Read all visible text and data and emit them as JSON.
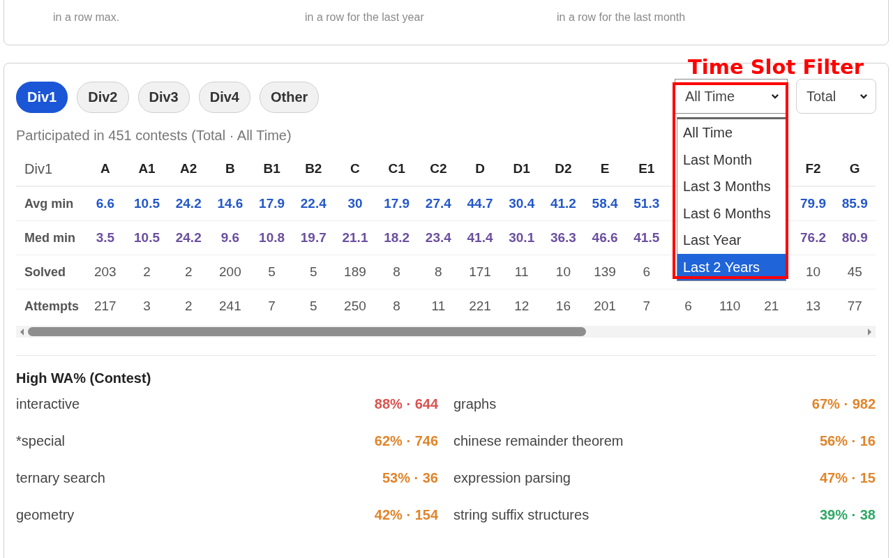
{
  "streaks": [
    {
      "caption": "in a row max."
    },
    {
      "caption": "in a row for the last year"
    },
    {
      "caption": "in a row for the last month"
    }
  ],
  "division_tabs": [
    {
      "label": "Div1",
      "selected": true
    },
    {
      "label": "Div2",
      "selected": false
    },
    {
      "label": "Div3",
      "selected": false
    },
    {
      "label": "Div4",
      "selected": false
    },
    {
      "label": "Other",
      "selected": false
    }
  ],
  "time_select": {
    "value": "All Time",
    "expanded": true,
    "options": [
      {
        "label": "All Time",
        "highlighted": false
      },
      {
        "label": "Last Month",
        "highlighted": false
      },
      {
        "label": "Last 3 Months",
        "highlighted": false
      },
      {
        "label": "Last 6 Months",
        "highlighted": false
      },
      {
        "label": "Last Year",
        "highlighted": false
      },
      {
        "label": "Last 2 Years",
        "highlighted": true
      }
    ]
  },
  "scope_select": {
    "value": "Total"
  },
  "annotation": {
    "label": "Time Slot Filter"
  },
  "summary": "Participated in 451 contests (Total · All Time)",
  "table": {
    "corner": "Div1",
    "columns": [
      "A",
      "A1",
      "A2",
      "B",
      "B1",
      "B2",
      "C",
      "C1",
      "C2",
      "D",
      "D1",
      "D2",
      "E",
      "E1",
      null,
      null,
      null,
      "F2",
      "G"
    ],
    "rows": [
      {
        "label": "Avg min",
        "kind": "avg",
        "cells": [
          "6.6",
          "10.5",
          "24.2",
          "14.6",
          "17.9",
          "22.4",
          "30",
          "17.9",
          "27.4",
          "44.7",
          "30.4",
          "41.2",
          "58.4",
          "51.3",
          null,
          null,
          null,
          "79.9",
          "85.9"
        ]
      },
      {
        "label": "Med min",
        "kind": "med",
        "cells": [
          "3.5",
          "10.5",
          "24.2",
          "9.6",
          "10.8",
          "19.7",
          "21.1",
          "18.2",
          "23.4",
          "41.4",
          "30.1",
          "36.3",
          "46.6",
          "41.5",
          null,
          null,
          null,
          "76.2",
          "80.9"
        ]
      },
      {
        "label": "Solved",
        "kind": "count",
        "cells": [
          "203",
          "2",
          "2",
          "200",
          "5",
          "5",
          "189",
          "8",
          "8",
          "171",
          "11",
          "10",
          "139",
          "6",
          null,
          null,
          null,
          "10",
          "45"
        ]
      },
      {
        "label": "Attempts",
        "kind": "count",
        "cells": [
          "217",
          "3",
          "2",
          "241",
          "7",
          "5",
          "250",
          "8",
          "11",
          "221",
          "12",
          "16",
          "201",
          "7",
          "6",
          "110",
          "21",
          "13",
          "77"
        ]
      }
    ]
  },
  "high_wa": {
    "title": "High WA% (Contest)",
    "items": [
      {
        "tag": "interactive",
        "stat": "88% · 644",
        "color": "#d9534f"
      },
      {
        "tag": "graphs",
        "stat": "67% · 982",
        "color": "#e0852b"
      },
      {
        "tag": "*special",
        "stat": "62% · 746",
        "color": "#e0852b"
      },
      {
        "tag": "chinese remainder theorem",
        "stat": "56% · 16",
        "color": "#e0852b"
      },
      {
        "tag": "ternary search",
        "stat": "53% · 36",
        "color": "#e0852b"
      },
      {
        "tag": "expression parsing",
        "stat": "47% · 15",
        "color": "#e0852b"
      },
      {
        "tag": "geometry",
        "stat": "42% · 154",
        "color": "#e0852b"
      },
      {
        "tag": "string suffix structures",
        "stat": "39% · 38",
        "color": "#2fa866"
      }
    ]
  }
}
